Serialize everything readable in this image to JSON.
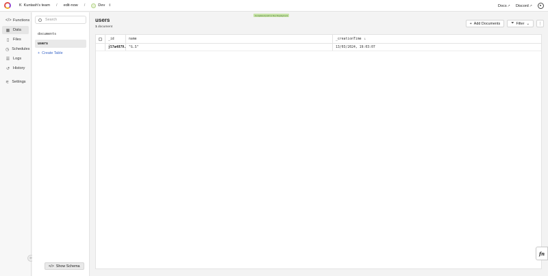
{
  "topbar": {
    "team_initial": "K",
    "team_name": "Kuntash's team",
    "project": "edit-now",
    "deployment": "Dev",
    "docs_label": "Docs",
    "discord_label": "Discord"
  },
  "nav": {
    "items": [
      {
        "label": "Functions",
        "icon": "code-icon"
      },
      {
        "label": "Data",
        "icon": "table-icon"
      },
      {
        "label": "Files",
        "icon": "file-icon"
      },
      {
        "label": "Schedules",
        "icon": "clock-icon"
      },
      {
        "label": "Logs",
        "icon": "list-icon"
      },
      {
        "label": "History",
        "icon": "history-icon"
      },
      {
        "label": "Settings",
        "icon": "sliders-icon"
      }
    ],
    "active": "Data"
  },
  "tables": {
    "search_placeholder": "Search",
    "items": [
      "documents",
      "users"
    ],
    "active": "users",
    "create_label": "Create Table",
    "show_schema_label": "Show Schema"
  },
  "main": {
    "deploy_notice": "Completed push to Dev Deployment",
    "title": "users",
    "count": "1",
    "count_suffix": "document",
    "add_label": "Add Documents",
    "filter_label": "Filter"
  },
  "grid": {
    "columns": [
      "_id",
      "name",
      "_creationTime"
    ],
    "rows": [
      {
        "id": "j57a4879...",
        "name": "\"G.S\"",
        "creation": "13/03/2024, 19:03:07"
      }
    ]
  },
  "fn_label": "fn",
  "colors": {
    "accent_link": "#3b67c8",
    "notice_bg": "#c6e3a6"
  }
}
